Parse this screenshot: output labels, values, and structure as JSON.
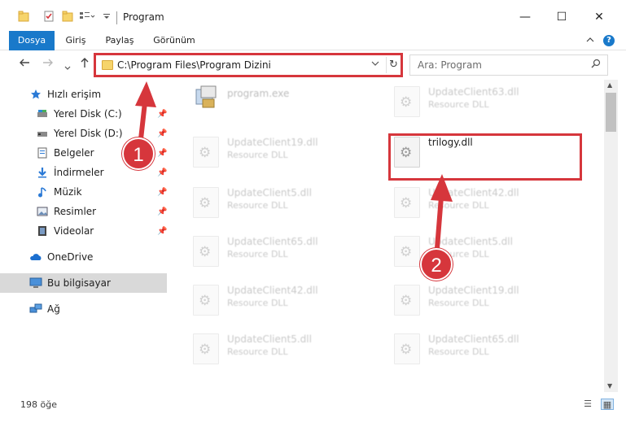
{
  "window": {
    "title": "Program",
    "minimize_glyph": "—",
    "maximize_glyph": "☐",
    "close_glyph": "✕"
  },
  "ribbon": {
    "tabs": [
      "Dosya",
      "Giriş",
      "Paylaş",
      "Görünüm"
    ],
    "help_label": "?"
  },
  "navigation": {
    "address": "C:\\Program Files\\Program Dizini",
    "search_placeholder": "Ara: Program"
  },
  "sidebar": {
    "items": [
      {
        "label": "Hızlı erişim",
        "icon": "star-icon"
      },
      {
        "label": "Yerel Disk (C:)",
        "icon": "drive-icon",
        "pinned": true
      },
      {
        "label": "Yerel Disk (D:)",
        "icon": "drive-icon",
        "pinned": true
      },
      {
        "label": "Belgeler",
        "icon": "documents-icon",
        "pinned": true
      },
      {
        "label": "İndirmeler",
        "icon": "download-icon",
        "pinned": true
      },
      {
        "label": "Müzik",
        "icon": "music-icon",
        "pinned": true
      },
      {
        "label": "Resimler",
        "icon": "pictures-icon",
        "pinned": true
      },
      {
        "label": "Videolar",
        "icon": "video-icon",
        "pinned": true
      },
      {
        "label": "OneDrive",
        "icon": "cloud-icon"
      },
      {
        "label": "Bu bilgisayar",
        "icon": "computer-icon",
        "selected": true
      },
      {
        "label": "Ağ",
        "icon": "network-icon"
      }
    ]
  },
  "files": {
    "left": [
      {
        "name": "program.exe",
        "type": ""
      },
      {
        "name": "UpdateClient19.dll",
        "type": "Resource DLL"
      },
      {
        "name": "UpdateClient5.dll",
        "type": "Resource DLL"
      },
      {
        "name": "UpdateClient65.dll",
        "type": "Resource DLL"
      },
      {
        "name": "UpdateClient42.dll",
        "type": "Resource DLL"
      },
      {
        "name": "UpdateClient5.dll",
        "type": "Resource DLL"
      }
    ],
    "right": [
      {
        "name": "UpdateClient63.dll",
        "type": "Resource DLL"
      },
      {
        "name": "trilogy.dll",
        "type": ""
      },
      {
        "name": "UpdateClient42.dll",
        "type": "Resource DLL"
      },
      {
        "name": "UpdateClient5.dll",
        "type": "Resource DLL"
      },
      {
        "name": "UpdateClient19.dll",
        "type": "Resource DLL"
      },
      {
        "name": "UpdateClient65.dll",
        "type": "Resource DLL"
      }
    ]
  },
  "status": {
    "count_text": "198 öğe"
  },
  "annotations": {
    "badge1": "1",
    "badge2": "2",
    "color": "#d6363c"
  }
}
